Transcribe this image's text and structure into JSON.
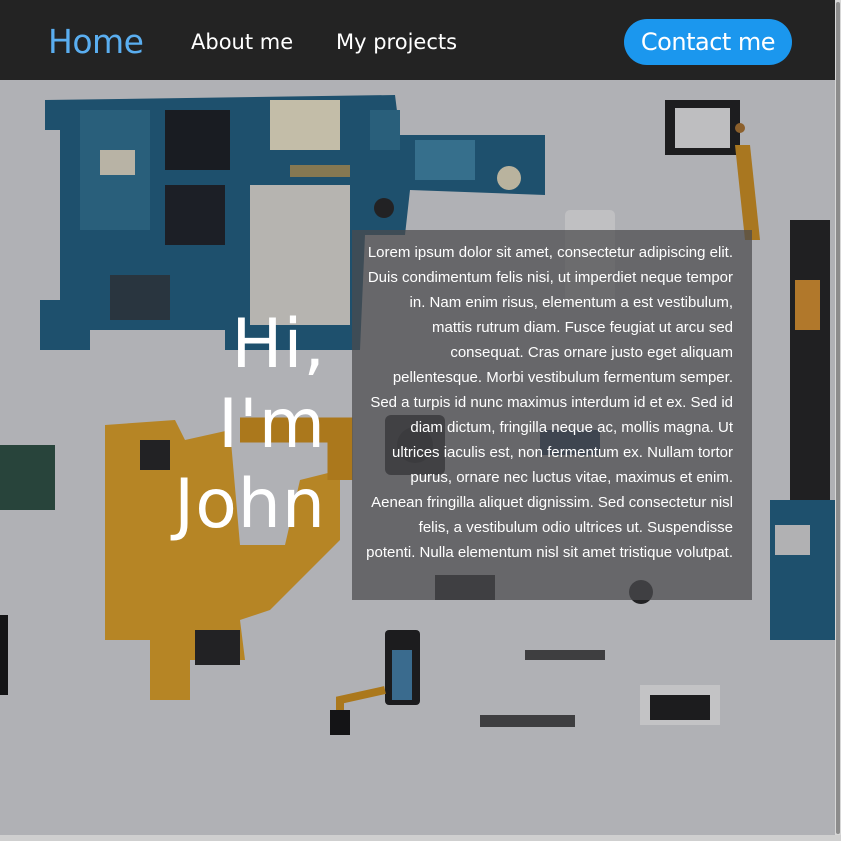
{
  "nav": {
    "home": "Home",
    "about": "About me",
    "projects": "My projects",
    "contact": "Contact me"
  },
  "hero": {
    "greeting": "Hi,\nI'm\nJohn",
    "about_text": "Lorem ipsum dolor sit amet, consectetur adipiscing elit. Duis condimentum felis nisi, ut imperdiet neque tempor in. Nam enim risus, elementum a est vestibulum, mattis rutrum diam. Fusce feugiat ut arcu sed consequat. Cras ornare justo eget aliquam pellentesque. Morbi vestibulum fermentum semper. Sed a turpis id nunc maximus interdum id et ex. Sed id diam dictum, fringilla neque ac, mollis magna. Ut ultrices iaculis est, non fermentum ex. Nullam tortor purus, ornare nec luctus vitae, maximus et enim. Aenean fringilla aliquet dignissim. Sed consectetur nisl felis, a vestibulum odio ultrices ut. Suspendisse potenti. Nulla elementum nisl sit amet tristique volutpat."
  },
  "colors": {
    "navbar_bg": "#232323",
    "home_link": "#5aaef0",
    "contact_button": "#1b97ee"
  }
}
